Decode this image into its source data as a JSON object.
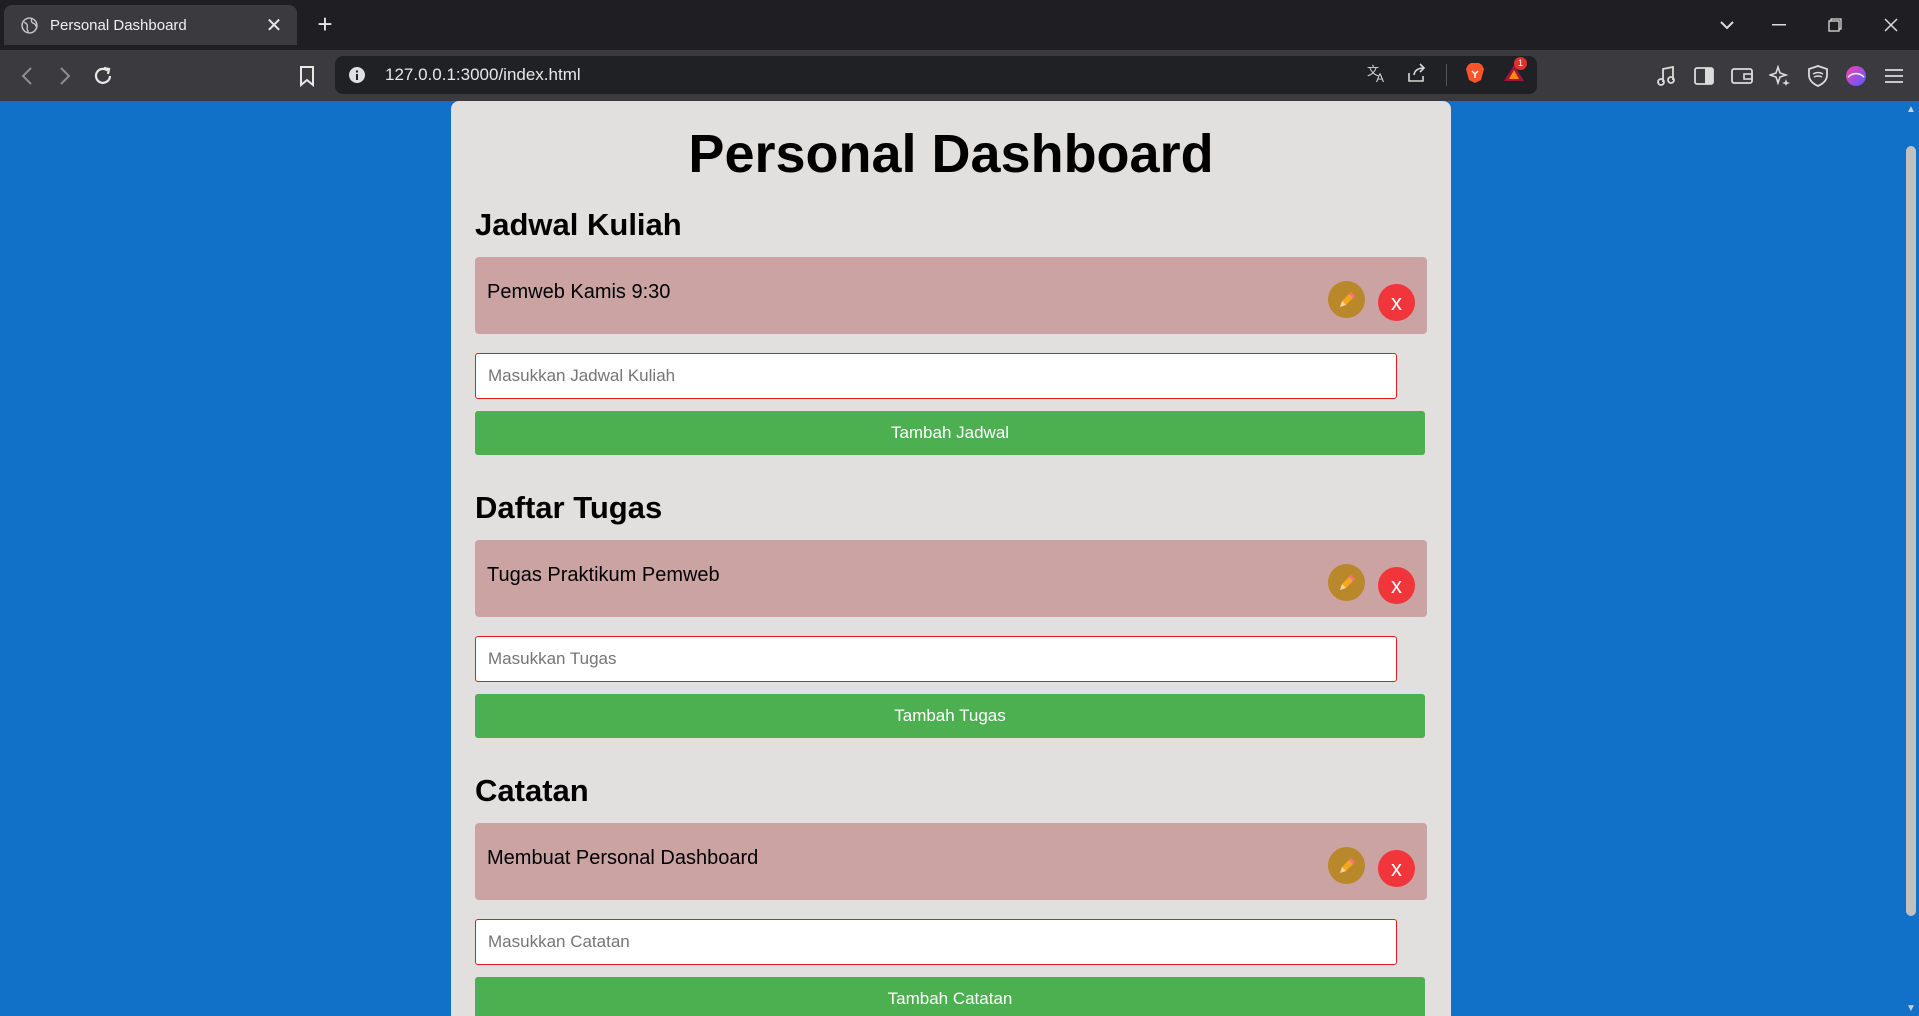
{
  "browser": {
    "tab_title": "Personal Dashboard",
    "tab_close": "✕",
    "new_tab": "+",
    "url": "127.0.0.1:3000/index.html",
    "badge_count": "1"
  },
  "page": {
    "title": "Personal Dashboard"
  },
  "sections": [
    {
      "heading": "Jadwal Kuliah",
      "item": "Pemweb Kamis 9:30",
      "placeholder": "Masukkan Jadwal Kuliah",
      "button": "Tambah Jadwal"
    },
    {
      "heading": "Daftar Tugas",
      "item": "Tugas Praktikum Pemweb",
      "placeholder": "Masukkan Tugas",
      "button": "Tambah Tugas"
    },
    {
      "heading": "Catatan",
      "item": "Membuat Personal Dashboard",
      "placeholder": "Masukkan Catatan",
      "button": "Tambah Catatan"
    }
  ],
  "delete_label": "x",
  "colors": {
    "page_bg": "#1170c8",
    "card_bg": "#e2dfdf",
    "item_bg": "#cca3a3",
    "edit_btn": "#b8882a",
    "delete_btn": "#f0363a",
    "add_btn": "#4caf50",
    "input_border": "#e01e1e"
  },
  "icons": {
    "favicon": "globe-icon",
    "edit": "pencil-icon",
    "translate": "translate-icon",
    "share": "share-icon",
    "brave": "brave-lion-icon",
    "rewards": "brave-rewards-icon"
  }
}
